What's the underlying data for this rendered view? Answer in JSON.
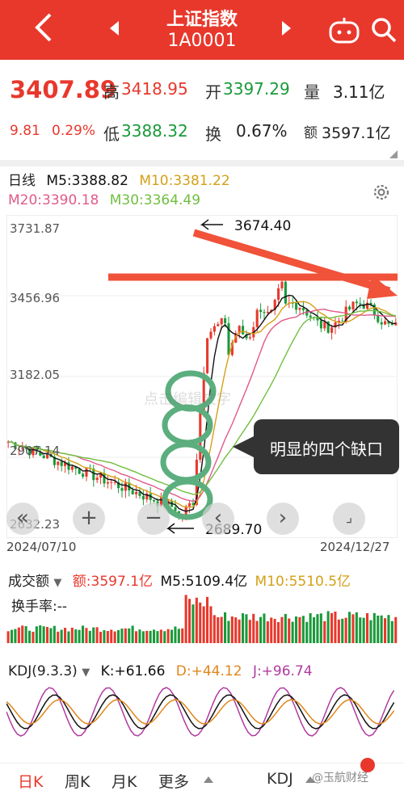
{
  "header": {
    "title": "上证指数",
    "code": "1A0001"
  },
  "quote": {
    "price": "3407.89",
    "change": "9.81",
    "change_pct": "0.29%",
    "high_label": "高",
    "high": "3418.95",
    "open_label": "开",
    "open": "3397.29",
    "vol_label": "量",
    "vol": "3.11亿",
    "low_label": "低",
    "low": "3388.32",
    "turnover_label": "换",
    "turnover": "0.67%",
    "amount_label": "额",
    "amount": "3597.1亿"
  },
  "ma": {
    "period": "日线",
    "m5": "M5:3388.82",
    "m10": "M10:3381.22",
    "m20": "M20:3390.18",
    "m30": "M30:3364.49"
  },
  "price_axis": {
    "t1": "3731.87",
    "t2": "3456.96",
    "t3": "3182.05",
    "t4": "2907.14",
    "t5": "2632.23"
  },
  "annotations": {
    "high": "3674.40",
    "low": "2689.70",
    "callout": "明显的四个缺口",
    "watermark": "点击编辑文字"
  },
  "dates": {
    "start": "2024/07/10",
    "end": "2024/12/27"
  },
  "volume": {
    "label": "成交额",
    "amount": "额:3597.1亿",
    "m5": "M5:5109.4亿",
    "m10": "M10:5510.5亿",
    "turnover": "换手率:--"
  },
  "kdj": {
    "label": "KDJ(9.3.3)",
    "k": "K:+61.66",
    "d": "D:+44.12",
    "j": "J:+96.74"
  },
  "bottom_tabs": [
    "日K",
    "周K",
    "月K",
    "更多",
    "KDJ"
  ],
  "watermark_bottom": "@玉航财经",
  "colors": {
    "up": "#e8382c",
    "down": "#1a9a3a",
    "m5": "#111111",
    "m10": "#d4a017",
    "m20": "#e05a8a",
    "m30": "#6fbf3f",
    "gap": "#5cae7e"
  },
  "chart_data": {
    "type": "candlestick",
    "ylim": [
      2632.23,
      3731.87
    ],
    "x_range": [
      "2024/07/10",
      "2024/12/27"
    ],
    "high_point": 3674.4,
    "low_point": 2689.7
  }
}
